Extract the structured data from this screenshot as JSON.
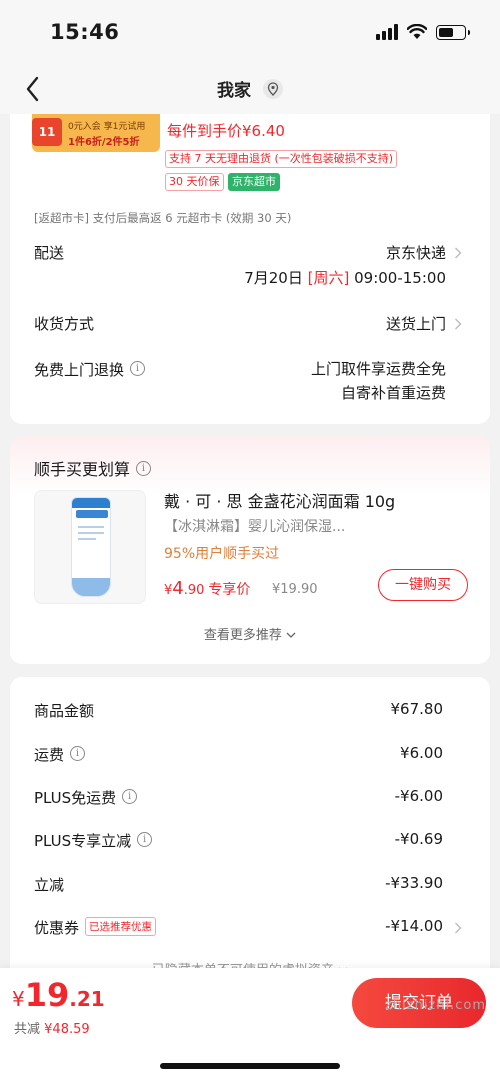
{
  "status_bar": {
    "time": "15:46"
  },
  "nav": {
    "title": "我家"
  },
  "product": {
    "promo_badge": "11",
    "promo_line1": "0元入会 享1元试用",
    "promo_line2": "1件6折/2件5折",
    "unit_price": "每件到手价¥6.40",
    "tag_return": "支持 7 天无理由退货 (一次性包装破损不支持)",
    "tag_price_protect": "30 天价保",
    "tag_store": "京东超市"
  },
  "rebate_note": "[返超市卡] 支付后最高返 6 元超市卡 (效期 30 天)",
  "delivery": {
    "label": "配送",
    "carrier": "京东快递",
    "date": "7月20日",
    "weekday": "[周六]",
    "time_window": "09:00-15:00"
  },
  "receive": {
    "label": "收货方式",
    "value": "送货上门"
  },
  "free_return": {
    "label": "免费上门退换",
    "value_line1": "上门取件享运费全免",
    "value_line2": "自寄补首重运费"
  },
  "recommend": {
    "title": "顺手买更划算",
    "item": {
      "name": "戴 · 可 · 思 金盏花沁润面霜 10g",
      "desc": "【冰淇淋霜】婴儿沁润保湿...",
      "pct": "95%用户顺手买过",
      "price_currency": "¥",
      "price_int": "4",
      "price_dec": ".90",
      "price_label": "专享价",
      "orig_price": "¥19.90",
      "buy_label": "一键购买"
    },
    "more_label": "查看更多推荐"
  },
  "summary": {
    "rows": [
      {
        "label": "商品金额",
        "value": "¥67.80"
      },
      {
        "label": "运费",
        "value": "¥6.00"
      },
      {
        "label": "PLUS免运费",
        "value": "-¥6.00"
      },
      {
        "label": "PLUS专享立减",
        "value": "-¥0.69"
      },
      {
        "label": "立减",
        "value": "-¥33.90"
      },
      {
        "label": "优惠券",
        "value": "-¥14.00",
        "tag": "已选推荐优惠"
      }
    ],
    "hidden_assets": "已隐藏本单不可使用的虚拟资产"
  },
  "footer": {
    "currency": "¥",
    "total_int": "19",
    "total_dec": ".21",
    "saved_label": "共减",
    "saved_value": "¥48.59",
    "submit_label": "提交订单"
  },
  "watermark": "zhizhizhi.com",
  "colors": {
    "accent": "#f2272d",
    "green": "#2fb36b",
    "orange": "#e0803a"
  }
}
